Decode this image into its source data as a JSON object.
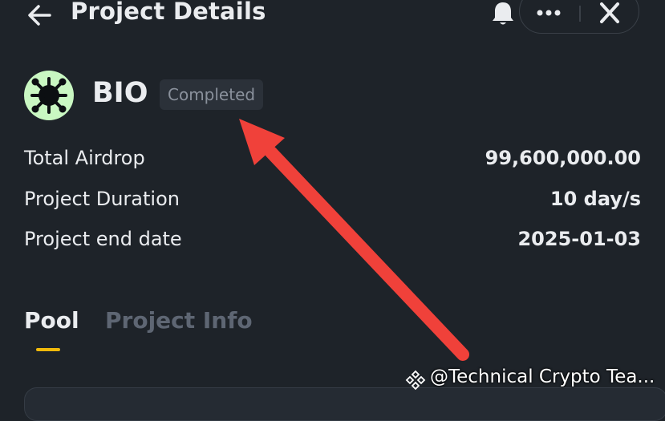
{
  "header": {
    "title": "Project Details",
    "back_icon": "arrow-left-icon",
    "bell_icon": "bell-icon",
    "more_icon": "more-horizontal-icon",
    "close_icon": "close-icon"
  },
  "project": {
    "token": "BIO",
    "status": "Completed",
    "logo_color": "#c9f7c2"
  },
  "details": [
    {
      "label": "Total Airdrop",
      "value": "99,600,000.00"
    },
    {
      "label": "Project Duration",
      "value": "10 day/s"
    },
    {
      "label": "Project end date",
      "value": "2025-01-03"
    }
  ],
  "tabs": [
    {
      "label": "Pool",
      "active": true
    },
    {
      "label": "Project Info",
      "active": false
    }
  ],
  "watermark": {
    "text": "@Technical Crypto Tea...",
    "icon": "binance-square-icon"
  },
  "annotation": {
    "icon": "red-arrow-icon",
    "color": "#f0413a"
  },
  "colors": {
    "background": "#1e2329",
    "accent": "#f0b90b",
    "muted": "#5e6673"
  }
}
